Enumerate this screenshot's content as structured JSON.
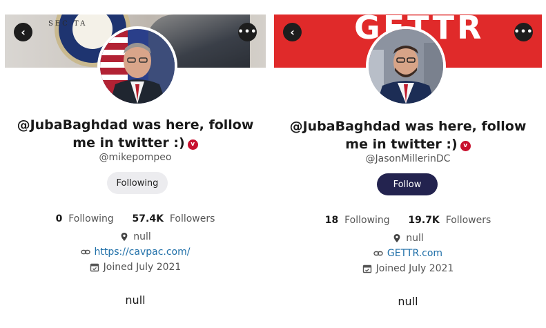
{
  "profiles": [
    {
      "name_line1": "@JubaBaghdad was here, follow",
      "name_line2": "me in twitter :)",
      "verified_badge": "v",
      "handle": "@mikepompeo",
      "follow_button": "Following",
      "following_count": "0",
      "following_label": "Following",
      "followers_count": "57.4K",
      "followers_label": "Followers",
      "location": "null",
      "website": "https://cavpac.com/",
      "joined": "Joined July 2021",
      "bio": "null",
      "banner_text": "SEC   TA"
    },
    {
      "name_line1": "@JubaBaghdad was here, follow",
      "name_line2": "me in twitter :)",
      "verified_badge": "v",
      "handle": "@JasonMillerinDC",
      "follow_button": "Follow",
      "following_count": "18",
      "following_label": "Following",
      "followers_count": "19.7K",
      "followers_label": "Followers",
      "location": "null",
      "website": "GETTR.com",
      "joined": "Joined July 2021",
      "bio": "null",
      "banner_text": "GETTR"
    }
  ],
  "icons": {
    "back": "chevron-left-icon",
    "more": "more-horizontal-icon",
    "location": "map-pin-icon",
    "link": "link-icon",
    "calendar": "calendar-icon"
  },
  "colors": {
    "gettr_red": "#e02a2a",
    "follow_dark": "#23234f",
    "link_blue": "#1f6fa8",
    "verified_red": "#c8102e"
  }
}
